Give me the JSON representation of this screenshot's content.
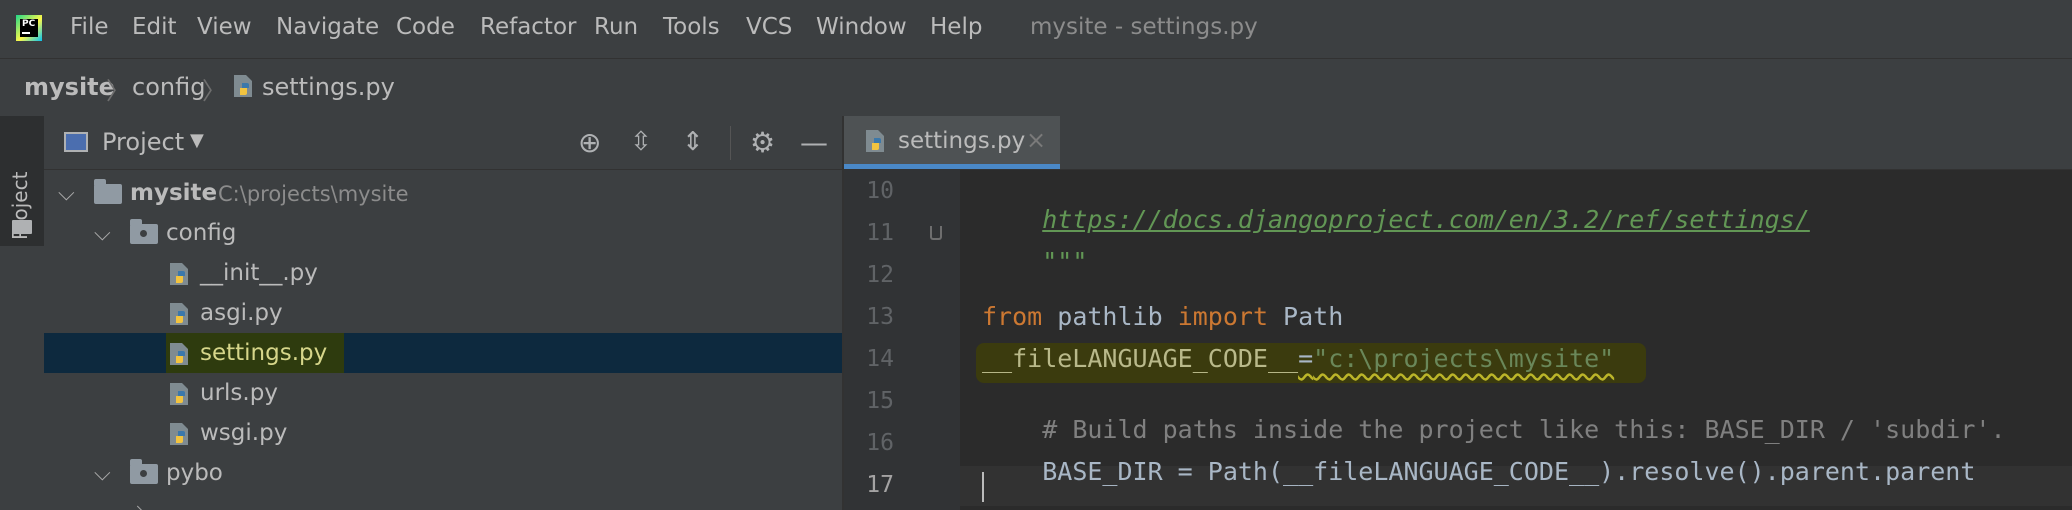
{
  "menubar": {
    "items": [
      "File",
      "Edit",
      "View",
      "Navigate",
      "Code",
      "Refactor",
      "Run",
      "Tools",
      "VCS",
      "Window",
      "Help"
    ],
    "window_title": "mysite - settings.py"
  },
  "breadcrumb": {
    "items": [
      "mysite",
      "config",
      "settings.py"
    ]
  },
  "tool_strip": {
    "project_label": "Project"
  },
  "project_panel": {
    "title": "Project",
    "tree": [
      {
        "label": "mysite",
        "path": "C:\\projects\\mysite"
      },
      {
        "label": "config"
      },
      {
        "label": "__init__.py"
      },
      {
        "label": "asgi.py"
      },
      {
        "label": "settings.py"
      },
      {
        "label": "urls.py"
      },
      {
        "label": "wsgi.py"
      },
      {
        "label": "pybo"
      }
    ]
  },
  "editor": {
    "tab_label": "settings.py",
    "line_numbers": [
      "10",
      "11",
      "12",
      "13",
      "14",
      "15",
      "16",
      "17"
    ],
    "lines": {
      "l10_link": "https://docs.djangoproject.com/en/3.2/ref/settings/",
      "l11_doc": "\"\"\"",
      "l13_from": "from",
      "l13_mod": " pathlib ",
      "l13_import": "import",
      "l13_name": " Path",
      "l14_name": "__fileLANGUAGE_CODE__",
      "l14_eq": "=",
      "l14_str": "\"c:\\projects\\mysite\"",
      "l15_comment": "# Build paths inside the project like this: BASE_DIR / 'subdir'.",
      "l16_code": "BASE_DIR = Path(__fileLANGUAGE_CODE__).resolve().parent.parent"
    }
  },
  "colors": {
    "background": "#2b2b2b",
    "panel": "#3c3f41",
    "selection": "#0d293e",
    "keyword": "#cc7832",
    "string": "#6a8759",
    "comment": "#808080",
    "accent": "#4a88c7"
  }
}
